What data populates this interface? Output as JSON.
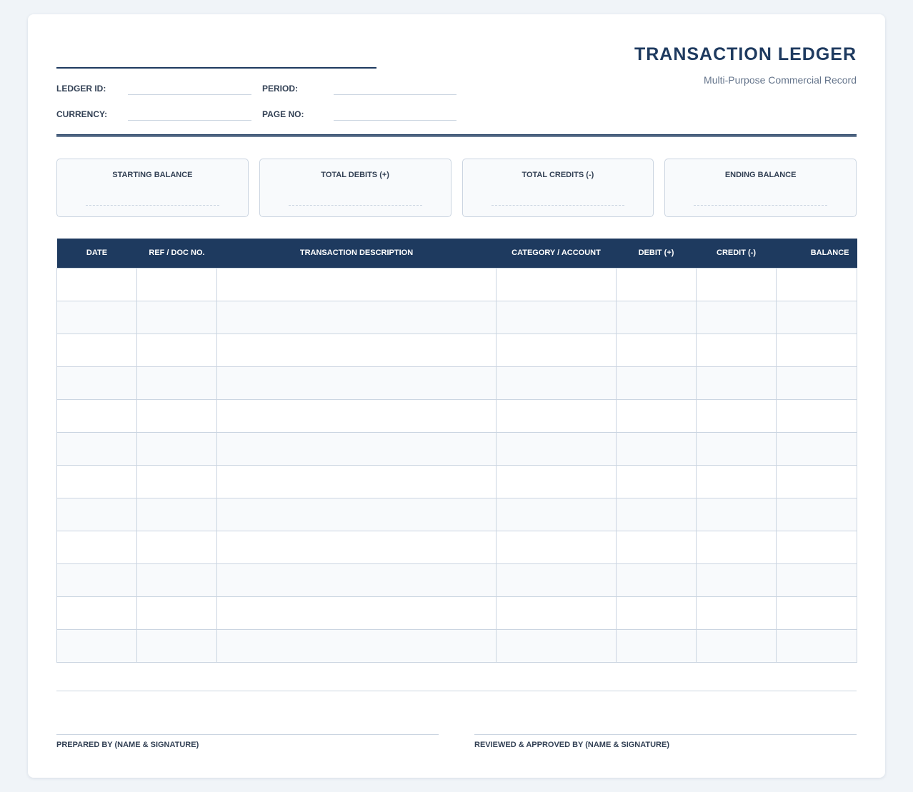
{
  "header": {
    "title": "TRANSACTION LEDGER",
    "subtitle": "Multi-Purpose Commercial Record",
    "fields": {
      "ledger_id": "LEDGER ID:",
      "period": "PERIOD:",
      "currency": "CURRENCY:",
      "page_no": "PAGE NO:"
    }
  },
  "summary": [
    {
      "label": "STARTING BALANCE",
      "value": ""
    },
    {
      "label": "TOTAL DEBITS (+)",
      "value": ""
    },
    {
      "label": "TOTAL CREDITS (-)",
      "value": ""
    },
    {
      "label": "ENDING BALANCE",
      "value": ""
    }
  ],
  "table": {
    "columns": [
      "DATE",
      "REF / DOC NO.",
      "TRANSACTION DESCRIPTION",
      "CATEGORY / ACCOUNT",
      "DEBIT (+)",
      "CREDIT (-)",
      "BALANCE"
    ],
    "rows": [
      [
        "",
        "",
        "",
        "",
        "",
        "",
        ""
      ],
      [
        "",
        "",
        "",
        "",
        "",
        "",
        ""
      ],
      [
        "",
        "",
        "",
        "",
        "",
        "",
        ""
      ],
      [
        "",
        "",
        "",
        "",
        "",
        "",
        ""
      ],
      [
        "",
        "",
        "",
        "",
        "",
        "",
        ""
      ],
      [
        "",
        "",
        "",
        "",
        "",
        "",
        ""
      ],
      [
        "",
        "",
        "",
        "",
        "",
        "",
        ""
      ],
      [
        "",
        "",
        "",
        "",
        "",
        "",
        ""
      ],
      [
        "",
        "",
        "",
        "",
        "",
        "",
        ""
      ],
      [
        "",
        "",
        "",
        "",
        "",
        "",
        ""
      ],
      [
        "",
        "",
        "",
        "",
        "",
        "",
        ""
      ],
      [
        "",
        "",
        "",
        "",
        "",
        "",
        ""
      ]
    ]
  },
  "footer": {
    "prepared_by": "PREPARED BY (NAME & SIGNATURE)",
    "reviewed_by": "REVIEWED & APPROVED BY (NAME & SIGNATURE)"
  },
  "colors": {
    "primary": "#1e3a5f",
    "border": "#cbd5e1",
    "muted_text": "#64748b",
    "alt_row": "#f8fafc",
    "page_bg": "#f0f4f8"
  }
}
